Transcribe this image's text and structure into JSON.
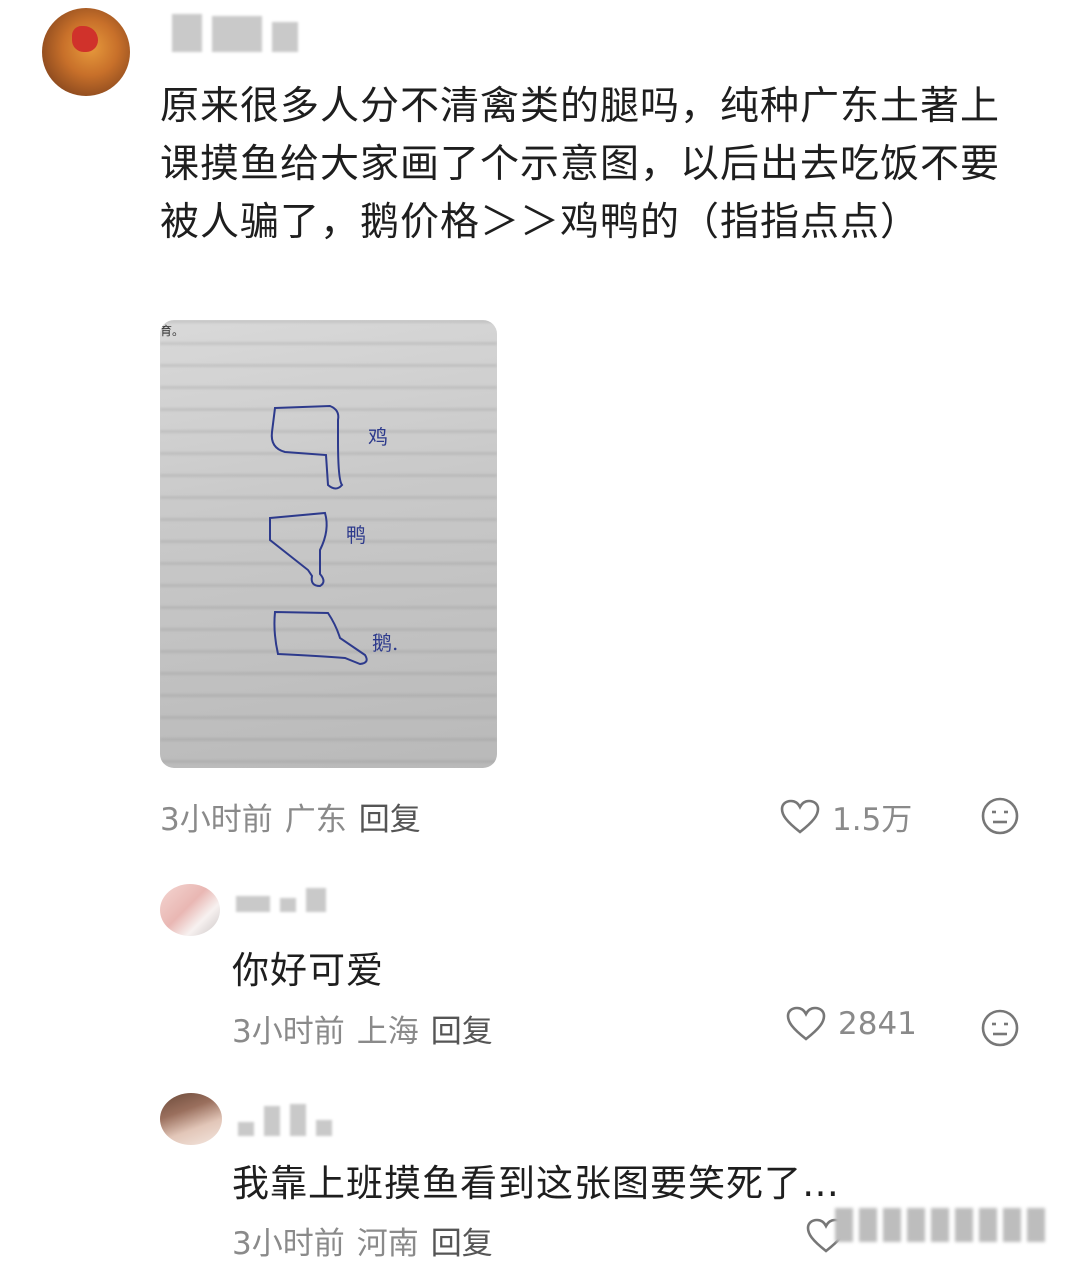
{
  "post": {
    "text": "原来很多人分不清禽类的腿吗，纯种广东土著上课摸鱼给大家画了个示意图，以后出去吃饭不要被人骗了，鹅价格＞＞鸡鸭的（指指点点）",
    "image": {
      "corner_text": "育。",
      "labels": [
        "鸡",
        "鸭",
        "鹅."
      ]
    },
    "time": "3小时前",
    "location": "广东",
    "reply_label": "回复",
    "likes": "1.5万"
  },
  "comments": [
    {
      "text": "你好可爱",
      "time": "3小时前",
      "location": "上海",
      "reply_label": "回复",
      "likes": "2841"
    },
    {
      "text": "我靠上班摸鱼看到这张图要笑死了…",
      "time": "3小时前",
      "location": "河南",
      "reply_label": "回复"
    }
  ],
  "icons": {
    "like": "heart-outline-icon",
    "emoji": "neutral-face-icon"
  },
  "colors": {
    "text": "#1e1e1e",
    "meta": "#8a8a8a",
    "icon": "#777777"
  }
}
